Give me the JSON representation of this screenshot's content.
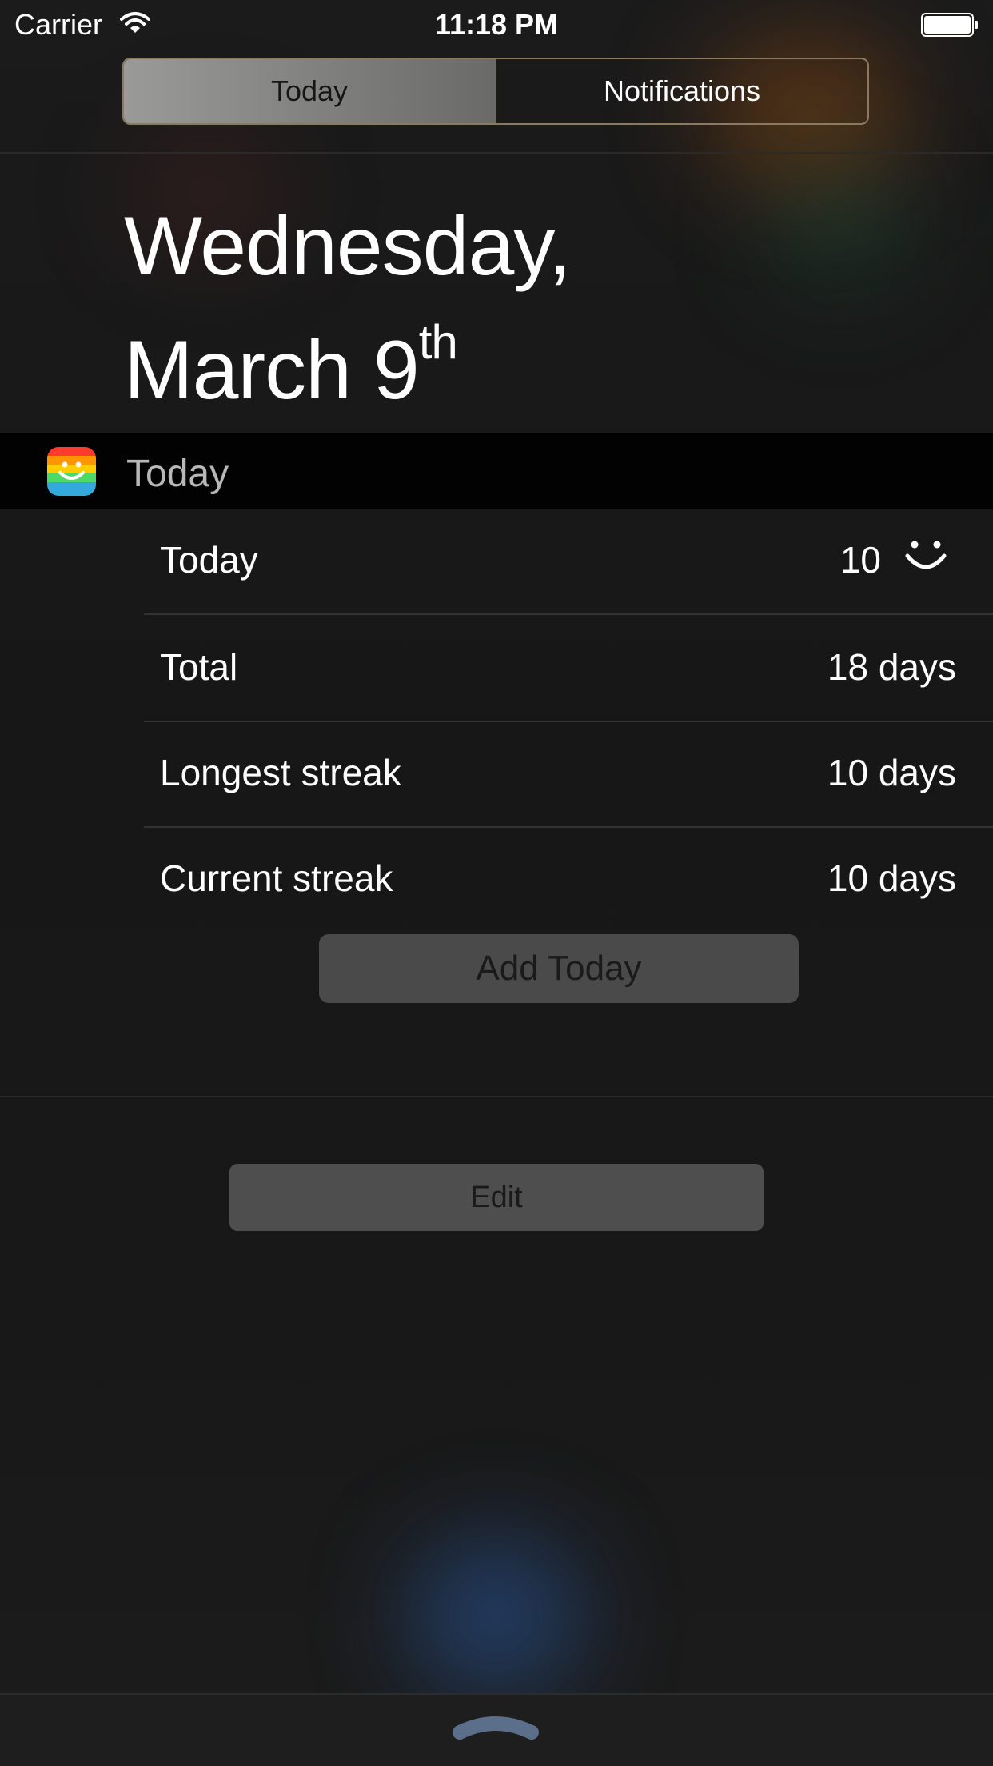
{
  "status_bar": {
    "carrier": "Carrier",
    "time": "11:18 PM",
    "wifi_icon": "wifi-icon",
    "battery_icon": "battery-full-icon"
  },
  "segmented_control": {
    "segments": [
      "Today",
      "Notifications"
    ],
    "selected": "Today"
  },
  "date": {
    "line1": "Wednesday,",
    "line2": "March 9",
    "suffix": "th"
  },
  "widget": {
    "title": "Today",
    "icon": "rainbow-smile-app-icon",
    "rows": [
      {
        "label": "Today",
        "value": "10",
        "icon": "smile-icon"
      },
      {
        "label": "Total",
        "value": "18 days"
      },
      {
        "label": "Longest streak",
        "value": "10 days"
      },
      {
        "label": "Current streak",
        "value": "10 days"
      }
    ],
    "add_button": "Add Today"
  },
  "edit_button": "Edit",
  "grabber_icon": "chevron-up-icon",
  "colors": {
    "background": "#161616",
    "widget_header": "#020202",
    "button": "#4a4a4a",
    "segment_selected": "#8a8a88"
  }
}
